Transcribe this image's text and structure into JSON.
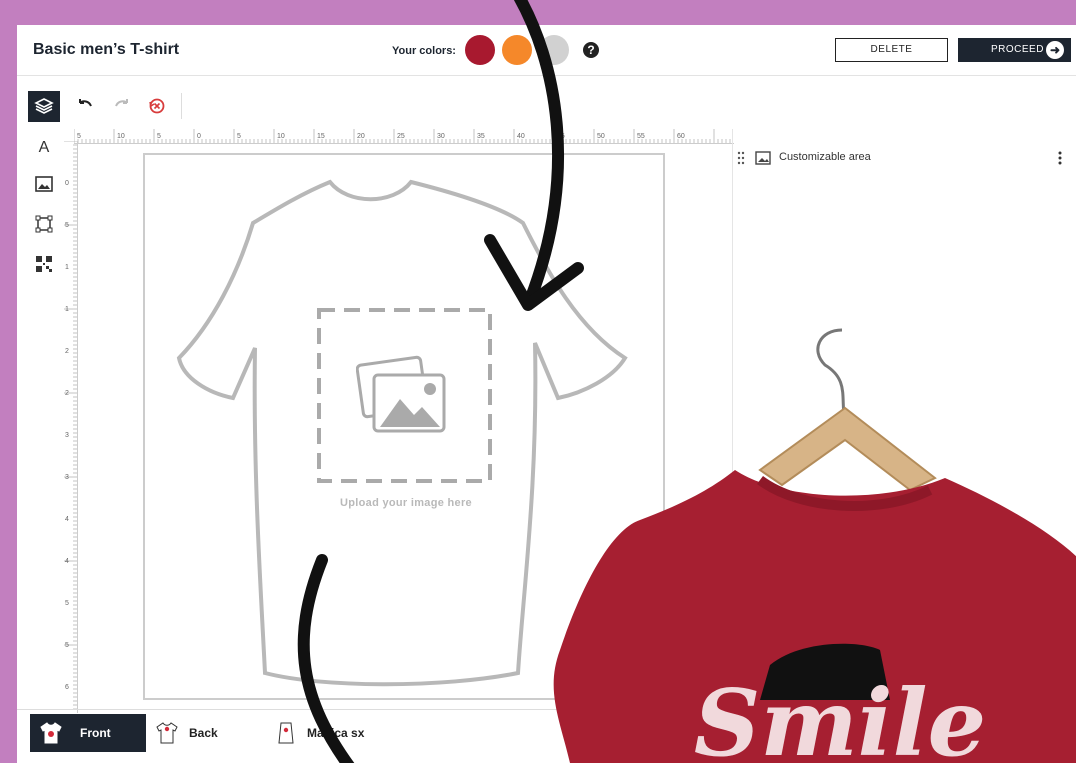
{
  "header": {
    "title": "Basic men’s T-shirt",
    "colors_label": "Your colors:",
    "swatches": [
      "#a8192f",
      "#f5882a",
      "#d1d1d1"
    ],
    "help_label": "?",
    "delete_label": "DELETE",
    "proceed_label": "PROCEED"
  },
  "ruler": {
    "h_ticks": [
      "5",
      "10",
      "5",
      "0",
      "5",
      "10",
      "15",
      "20",
      "25",
      "30",
      "35",
      "40",
      "45",
      "50",
      "55",
      "60"
    ],
    "v_ticks": [
      "0",
      "5",
      "1",
      "1",
      "2",
      "2",
      "3",
      "3",
      "4",
      "4",
      "5",
      "5",
      "6"
    ]
  },
  "canvas": {
    "upload_text": "Upload your image here"
  },
  "layers_panel": {
    "item_label": "Customizable area"
  },
  "views": {
    "front": "Front",
    "back": "Back",
    "sleeve": "Manica sx"
  },
  "colors": {
    "accent": "#1d2530",
    "frame": "#c27fbf",
    "undo_red": "#d83c3c",
    "shirt_red": "#a61f31"
  }
}
